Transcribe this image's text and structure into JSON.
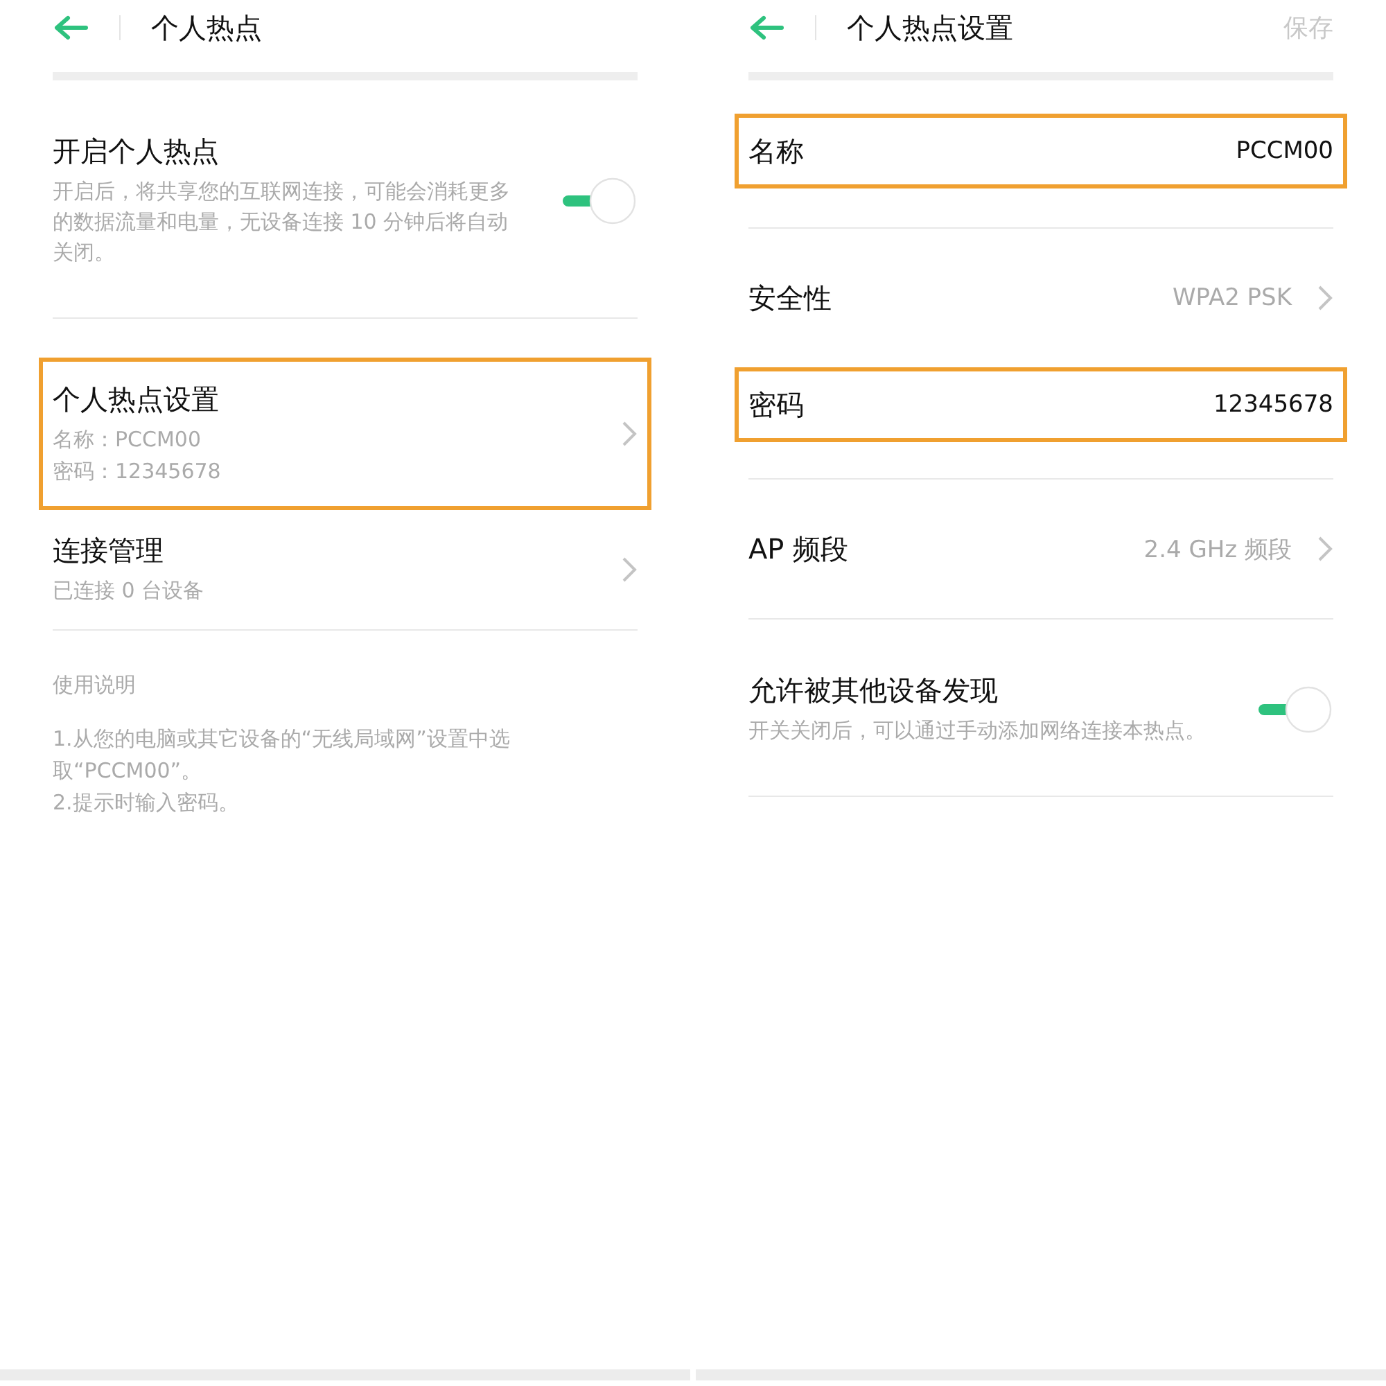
{
  "screens": [
    {
      "header": {
        "title": "个人热点"
      },
      "rows": [
        {
          "kind": "toggle",
          "title": "开启个人热点",
          "description": "开启后，将共享您的互联网连接，可能会消耗更多的数据流量和电量，无设备连接 10 分钟后将自动关闭。",
          "on": true,
          "highlighted": false
        },
        {
          "kind": "nav",
          "title": "个人热点设置",
          "lines": [
            "名称：PCCM00",
            "密码：12345678"
          ],
          "highlighted": true
        },
        {
          "kind": "nav",
          "title": "连接管理",
          "lines": [
            "已连接 0 台设备"
          ],
          "highlighted": false
        }
      ],
      "notes": {
        "heading": "使用说明",
        "lines": [
          "1.从您的电脑或其它设备的“无线局域网”设置中选取“PCCM00”。",
          "2.提示时输入密码。"
        ]
      }
    },
    {
      "header": {
        "title": "个人热点设置",
        "action": {
          "label": "保存",
          "disabled": true
        }
      },
      "rows": [
        {
          "kind": "value",
          "title": "名称",
          "value": "PCCM00",
          "highlighted": true
        },
        {
          "kind": "nav",
          "title": "安全性",
          "value": "WPA2 PSK",
          "highlighted": false
        },
        {
          "kind": "value",
          "title": "密码",
          "value": "12345678",
          "highlighted": true
        },
        {
          "kind": "nav",
          "title": "AP 频段",
          "value": "2.4 GHz 频段",
          "highlighted": false
        },
        {
          "kind": "toggle",
          "title": "允许被其他设备发现",
          "description": "开关关闭后，可以通过手动添加网络连接本热点。",
          "on": true,
          "highlighted": false
        }
      ]
    }
  ]
}
